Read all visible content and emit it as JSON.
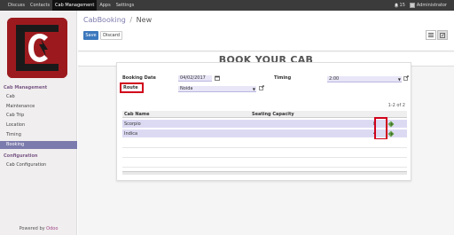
{
  "topbar": {
    "menu": [
      "Discuss",
      "Contacts",
      "Cab Management",
      "Apps",
      "Settings"
    ],
    "active": "Cab Management",
    "notifications": "15",
    "user": "Administrator"
  },
  "sidebar": {
    "section_cab": "Cab Management",
    "items": [
      "Cab",
      "Maintenance",
      "Cab Trip",
      "Location",
      "Timing",
      "Booking"
    ],
    "active_item": "Booking",
    "section_config": "Configuration",
    "config_items": [
      "Cab Configuration"
    ],
    "powered_by": "Powered by",
    "powered_brand": "Odoo"
  },
  "header": {
    "breadcrumb_parent": "CabBooking",
    "breadcrumb_current": "New",
    "save_label": "Save",
    "discard_label": "Discard"
  },
  "form": {
    "title": "BOOK YOUR CAB",
    "booking_date_label": "Booking Date",
    "booking_date_value": "04/02/2017",
    "route_label": "Route",
    "route_value": "Noida",
    "timing_label": "Timing",
    "timing_value": "2:00",
    "pager": "1-2 of 2",
    "columns": [
      "Cab Name",
      "Seating Capacity"
    ],
    "rows": [
      {
        "name": "Scorpio",
        "capacity": "8"
      },
      {
        "name": "Indica",
        "capacity": "4"
      }
    ]
  },
  "colors": {
    "topbar": "#3b3b3b",
    "accent": "#7c7bad",
    "save": "#3c78bd",
    "highlight": "#d0021b",
    "field_bg": "#e8e6f7"
  }
}
